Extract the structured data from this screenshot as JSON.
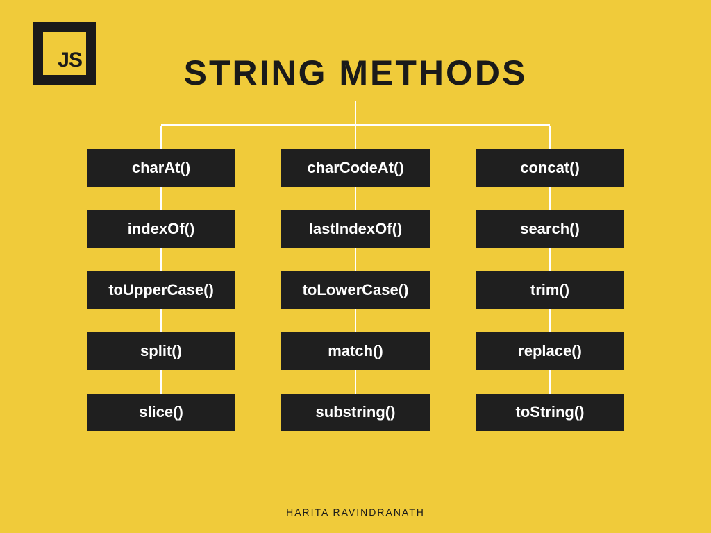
{
  "logo": {
    "text": "JS"
  },
  "title": "STRING METHODS",
  "columns": [
    {
      "methods": [
        "charAt()",
        "indexOf()",
        "toUpperCase()",
        "split()",
        "slice()"
      ]
    },
    {
      "methods": [
        "charCodeAt()",
        "lastIndexOf()",
        "toLowerCase()",
        "match()",
        "substring()"
      ]
    },
    {
      "methods": [
        "concat()",
        "search()",
        "trim()",
        "replace()",
        "toString()"
      ]
    }
  ],
  "author": "HARITA RAVINDRANATH"
}
